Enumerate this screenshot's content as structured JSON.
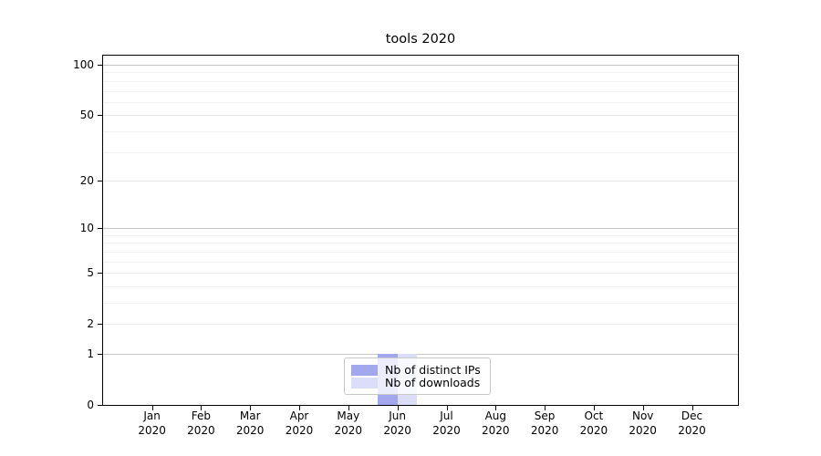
{
  "chart_data": {
    "type": "bar",
    "title": "tools 2020",
    "categories": [
      "Jan",
      "Feb",
      "Mar",
      "Apr",
      "May",
      "Jun",
      "Jul",
      "Aug",
      "Sep",
      "Oct",
      "Nov",
      "Dec"
    ],
    "category_year": "2020",
    "series": [
      {
        "name": "Nb of distinct IPs",
        "color": "#a2a7ee",
        "values": [
          0,
          0,
          0,
          0,
          0,
          1,
          0,
          0,
          0,
          0,
          0,
          0
        ]
      },
      {
        "name": "Nb of downloads",
        "color": "#dcdef9",
        "values": [
          0,
          0,
          0,
          0,
          0,
          1,
          0,
          0,
          0,
          0,
          0,
          0
        ]
      }
    ],
    "y_axis": {
      "scale": "log1p",
      "ticks": [
        100,
        50,
        20,
        10,
        5,
        2,
        1,
        0
      ],
      "emphasized_gridlines": [
        100,
        10,
        1
      ],
      "minor_gridlines": [
        3,
        4,
        6,
        7,
        8,
        9,
        30,
        40,
        60,
        70,
        80,
        90
      ],
      "range_max": 113
    },
    "x_axis": {
      "label_lines": 2
    },
    "legend": {
      "position": "lower center"
    },
    "grid": true,
    "background_color": "#ffffff",
    "spine_color": "#000000"
  }
}
